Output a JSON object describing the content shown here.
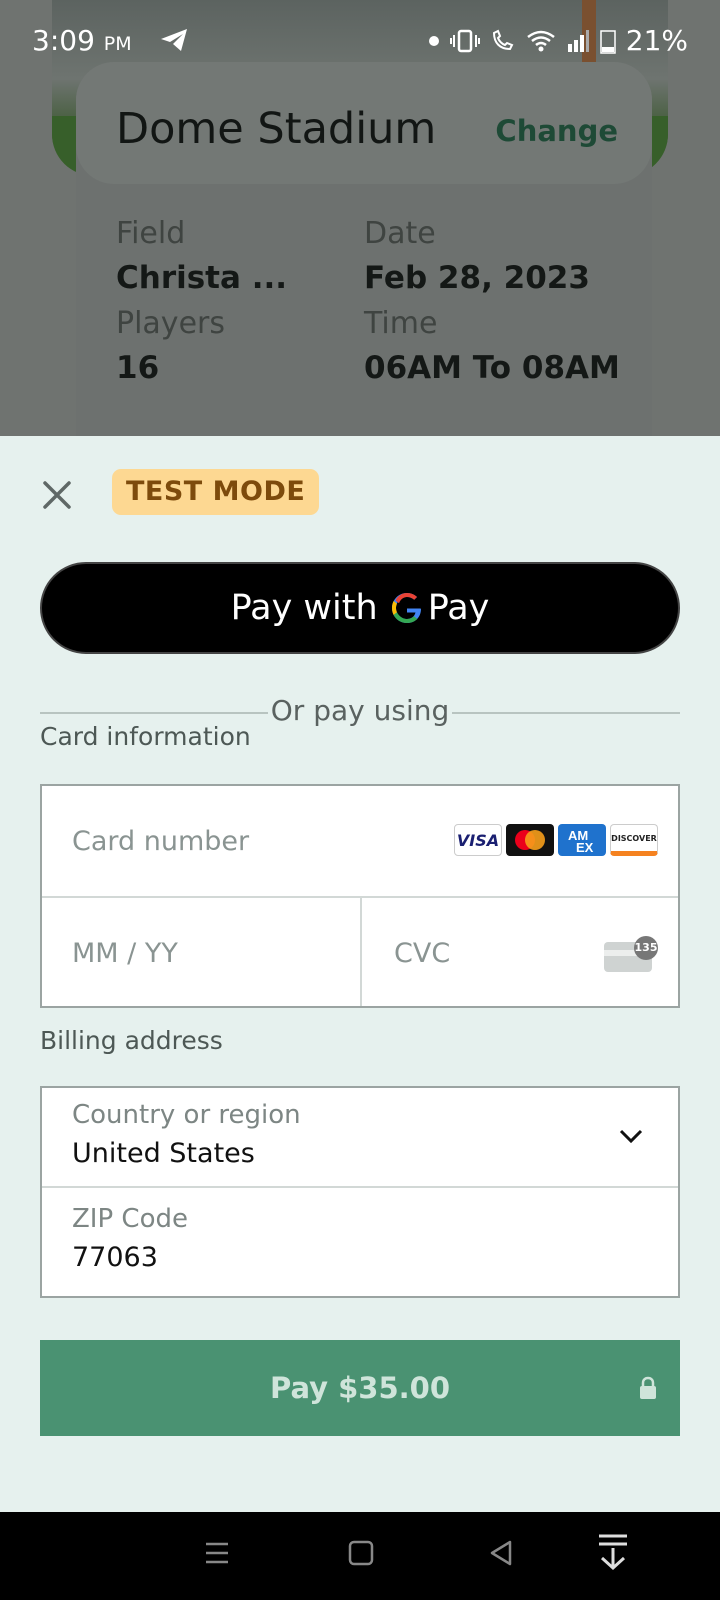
{
  "status_bar": {
    "time": "3:09",
    "ampm": "PM",
    "battery": "21%"
  },
  "venue": {
    "name": "Dome Stadium",
    "change_label": "Change",
    "field_label": "Field",
    "field_value": "Christa ...",
    "date_label": "Date",
    "date_value": "Feb 28, 2023",
    "players_label": "Players",
    "players_value": "16",
    "time_label": "Time",
    "time_value": "06AM To 08AM"
  },
  "sheet": {
    "test_mode": "TEST MODE",
    "gpay_prefix": "Pay with",
    "gpay_g": "G",
    "gpay_pay": "Pay",
    "or_text": "Or pay using",
    "card_section": "Card information",
    "card_number_placeholder": "Card number",
    "expiry_placeholder": "MM / YY",
    "cvc_placeholder": "CVC",
    "cvc_badge": "135",
    "brands": {
      "visa": "VISA",
      "discover": "DISCOVER"
    },
    "billing_section": "Billing address",
    "country_label": "Country or region",
    "country_value": "United States",
    "zip_label": "ZIP Code",
    "zip_value": "77063",
    "pay_button": "Pay $35.00"
  },
  "colors": {
    "sheet_bg": "#e6f1ee",
    "pay_button": "#4a9272",
    "test_badge": "#fdd892"
  }
}
